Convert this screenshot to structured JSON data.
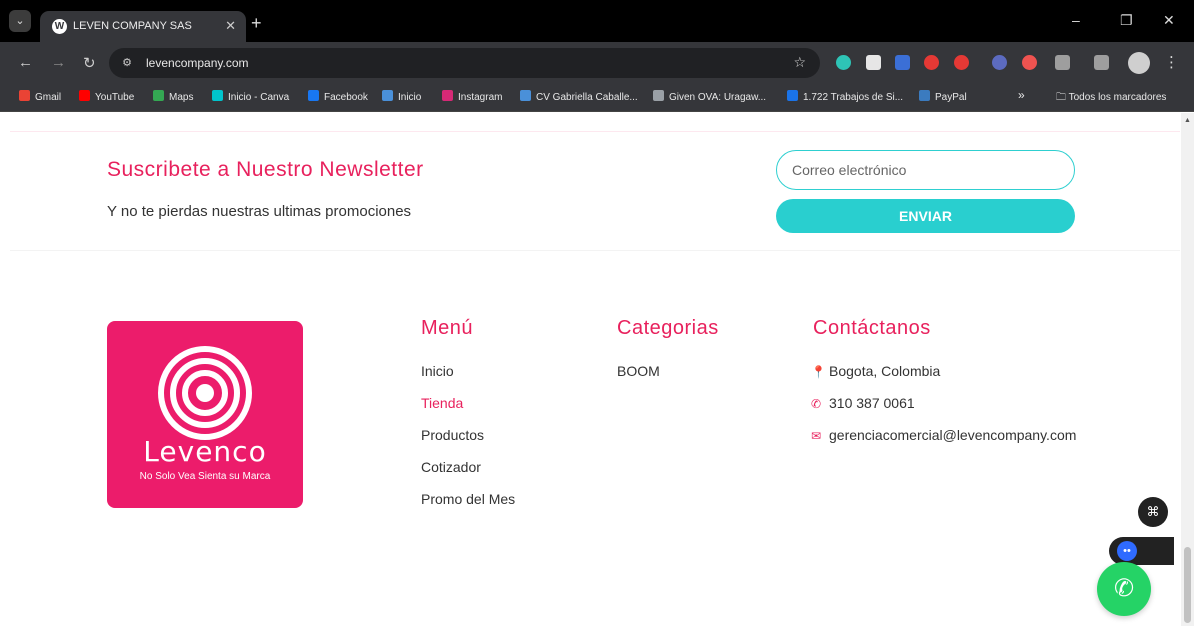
{
  "browser": {
    "tab_title": "LEVEN COMPANY SAS",
    "url": "levencompany.com",
    "bookmarks": [
      {
        "label": "Gmail",
        "color": "#ea4335"
      },
      {
        "label": "YouTube",
        "color": "#ff0000"
      },
      {
        "label": "Maps",
        "color": "#34a853"
      },
      {
        "label": "Inicio - Canva",
        "color": "#00c4cc"
      },
      {
        "label": "Facebook",
        "color": "#1877f2"
      },
      {
        "label": "Inicio",
        "color": "#4a90d9"
      },
      {
        "label": "Instagram",
        "color": "#d62976"
      },
      {
        "label": "CV Gabriella Caballe...",
        "color": "#4a90d9"
      },
      {
        "label": "Given OVA: Uragaw...",
        "color": "#9aa0a6"
      },
      {
        "label": "1.722 Trabajos de Si...",
        "color": "#1a73e8"
      },
      {
        "label": "PayPal",
        "color": "#3b7bbf"
      }
    ],
    "bookmarks_overflow": "»",
    "all_bookmarks": "Todos los marcadores"
  },
  "newsletter": {
    "title": "Suscribete a Nuestro Newsletter",
    "subtitle": "Y no te pierdas nuestras ultimas promociones",
    "email_placeholder": "Correo electrónico",
    "send_label": "ENVIAR"
  },
  "logo": {
    "word": "Levenco",
    "tagline": "No Solo Vea Sienta su Marca",
    "color": "#ec1c6b"
  },
  "menu": {
    "title": "Menú",
    "items": [
      "Inicio",
      "Tienda",
      "Productos",
      "Cotizador",
      "Promo del Mes"
    ]
  },
  "categories": {
    "title": "Categorias",
    "items": [
      "BOOM"
    ]
  },
  "contact": {
    "title": "Contáctanos",
    "location": "Bogota, Colombia",
    "phone": "310 387 0061",
    "email": "gerenciacomercial@levencompany.com"
  },
  "colors": {
    "accent": "#e8215d",
    "button": "#29cfcf"
  }
}
